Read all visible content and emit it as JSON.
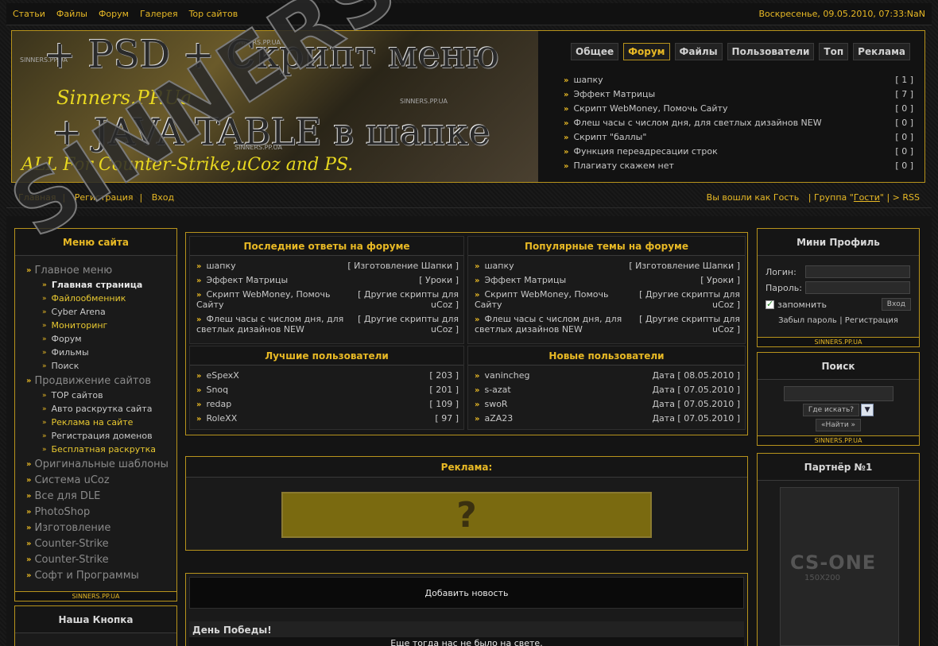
{
  "topbar": {
    "links": [
      "Статьи",
      "Файлы",
      "Форум",
      "Галерея",
      "Top сайтов"
    ],
    "date": "Воскресенье, 09.05.2010, 07:33:NaN"
  },
  "banner": {
    "line1": "+ PSD + Скрипт меню",
    "line2": "Sinners.PP.Ua",
    "line3": "+ JAVA TABLE в шапке",
    "line4": "ALL For Counter-Strike,uCoz and PS.",
    "mark": "SINNERS.PP.UA"
  },
  "header_tabs": [
    "Общее",
    "Форум",
    "Файлы",
    "Пользователи",
    "Топ",
    "Реклама"
  ],
  "header_list": [
    {
      "title": "шапку",
      "count": "[ 1 ]"
    },
    {
      "title": "Эффект Матрицы",
      "count": "[ 7 ]"
    },
    {
      "title": "Скрипт WebMoney, Помочь Сайту",
      "count": "[ 0 ]"
    },
    {
      "title": "Флеш часы с числом дня, для светлых дизайнов NEW",
      "count": "[ 0 ]"
    },
    {
      "title": "Скрипт \"баллы\"",
      "count": "[ 0 ]"
    },
    {
      "title": "Функция переадресации строк",
      "count": "[ 0 ]"
    },
    {
      "title": "Плагиату скажем нет",
      "count": "[ 0 ]"
    }
  ],
  "navbar": {
    "home": "Главная",
    "register": "Регистрация",
    "login": "Вход",
    "guest_prefix": "Вы вошли как",
    "guest_name": "Гость",
    "group_prefix": "| Группа \"",
    "group_name": "Гости",
    "group_suffix": "\"",
    "rss": "| > RSS"
  },
  "menu": {
    "title": "Меню сайта",
    "footer": "SINNERS.PP.UA",
    "sections": [
      {
        "label": "Главное меню",
        "items": [
          {
            "label": "Главная страница",
            "style": "bold"
          },
          {
            "label": "Файлообменник",
            "style": "yellow"
          },
          {
            "label": "Cyber Arena",
            "style": ""
          },
          {
            "label": "Мониторинг",
            "style": "yellow"
          },
          {
            "label": "Форум",
            "style": ""
          },
          {
            "label": "Фильмы",
            "style": ""
          },
          {
            "label": "Поиск",
            "style": ""
          }
        ]
      },
      {
        "label": "Продвижение сайтов",
        "items": [
          {
            "label": "TOP сайтов",
            "style": ""
          },
          {
            "label": "Авто раскрутка сайта",
            "style": ""
          },
          {
            "label": "Реклама на сайте",
            "style": "yellow"
          },
          {
            "label": "Регистрация доменов",
            "style": ""
          },
          {
            "label": "Бесплатная раскрутка",
            "style": "yellow"
          }
        ]
      },
      {
        "label": "Оригинальные шаблоны",
        "items": []
      },
      {
        "label": "Система uCoz",
        "items": []
      },
      {
        "label": "Все для DLE",
        "items": []
      },
      {
        "label": "PhotoShop",
        "items": []
      },
      {
        "label": "Изготовление",
        "items": []
      },
      {
        "label": "Counter-Strike",
        "items": []
      },
      {
        "label": "Counter-Strike",
        "items": []
      },
      {
        "label": "Софт и Программы",
        "items": []
      }
    ]
  },
  "button_block": {
    "title": "Наша Кнопка"
  },
  "forum_recent": {
    "title": "Последние ответы на форуме",
    "items": [
      {
        "name": "шапку",
        "cat": "[ Изготовление Шапки ]"
      },
      {
        "name": "Эффект Матрицы",
        "cat": "[ Уроки ]"
      },
      {
        "name": "Скрипт WebMoney, Помочь Сайту",
        "cat": "[ Другие скрипты для uCoz ]"
      },
      {
        "name": "Флеш часы с числом дня, для светлых дизайнов NEW",
        "cat": "[ Другие скрипты для uCoz ]"
      }
    ]
  },
  "forum_popular": {
    "title": "Популярные темы на форуме",
    "items": [
      {
        "name": "шапку",
        "cat": "[ Изготовление Шапки ]"
      },
      {
        "name": "Эффект Матрицы",
        "cat": "[ Уроки ]"
      },
      {
        "name": "Скрипт WebMoney, Помочь Сайту",
        "cat": "[ Другие скрипты для uCoz ]"
      },
      {
        "name": "Флеш часы с числом дня, для светлых дизайнов NEW",
        "cat": "[ Другие скрипты для uCoz ]"
      }
    ]
  },
  "best_users": {
    "title": "Лучшие пользователи",
    "items": [
      {
        "name": "eSpexX",
        "val": "[ 203 ]"
      },
      {
        "name": "Snoq",
        "val": "[ 201 ]"
      },
      {
        "name": "redap",
        "val": "[ 109 ]"
      },
      {
        "name": "RoleXX",
        "val": "[ 97 ]"
      }
    ]
  },
  "new_users": {
    "title": "Новые пользователи",
    "items": [
      {
        "name": "vanincheg",
        "val": "Дата [ 08.05.2010 ]"
      },
      {
        "name": "s-azat",
        "val": "Дата [ 07.05.2010 ]"
      },
      {
        "name": "swoR",
        "val": "Дата [ 07.05.2010 ]"
      },
      {
        "name": "aZA23",
        "val": "Дата [ 07.05.2010 ]"
      }
    ]
  },
  "ads": {
    "title": "Реклама:",
    "glyph": "?"
  },
  "news": {
    "add_label": "Добавить новость",
    "post_title": "День Победы!",
    "post_text": "Еще тогда нас не было на свете."
  },
  "profile": {
    "title": "Мини Профиль",
    "login_label": "Логин:",
    "password_label": "Пароль:",
    "remember": "запомнить",
    "enter": "Вход",
    "forgot": "Забыл пароль",
    "register": "Регистрация",
    "footer": "SINNERS.PP.UA"
  },
  "search": {
    "title": "Поиск",
    "where": "Где искать?",
    "find": "«Найти »",
    "footer": "SINNERS.PP.UA"
  },
  "partner": {
    "title": "Партнёр №1",
    "logo": "CS-ONE",
    "size": "150X200"
  },
  "watermark": "SINNERS.PP.UA",
  "colors": {
    "accent": "#e8b925",
    "border": "#b7931c",
    "bg": "#151515"
  }
}
